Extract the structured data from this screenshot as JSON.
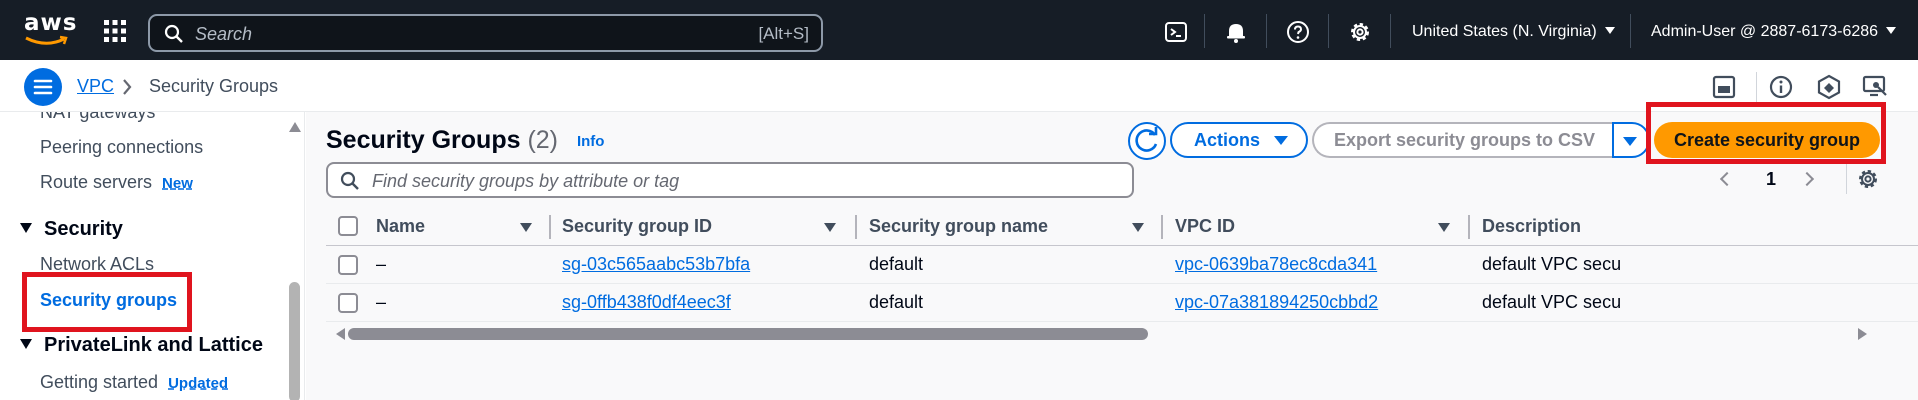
{
  "topbar": {
    "logo": "aws",
    "search_placeholder": "Search",
    "search_shortcut": "[Alt+S]",
    "region": "United States (N. Virginia)",
    "account": "Admin-User @ 2887-6173-6286",
    "icons": [
      "grid-icon",
      "search-icon",
      "cloudshell-icon",
      "bell-icon",
      "help-icon",
      "gear-icon"
    ]
  },
  "breadcrumb": {
    "root": "VPC",
    "current": "Security Groups"
  },
  "sidebar": {
    "items_top": [
      {
        "label": "NAT gateways"
      },
      {
        "label": "Peering connections"
      },
      {
        "label": "Route servers",
        "badge": "New"
      }
    ],
    "section_security": "Security",
    "security_items": [
      {
        "label": "Network ACLs"
      },
      {
        "label": "Security groups",
        "active": true
      }
    ],
    "section_privatelink": "PrivateLink and Lattice",
    "privatelink_items": [
      {
        "label": "Getting started",
        "badge": "Updated"
      }
    ]
  },
  "main": {
    "title": "Security Groups",
    "count": "(2)",
    "info": "Info",
    "actions_label": "Actions",
    "export_label": "Export security groups to CSV",
    "create_label": "Create security group",
    "filter_placeholder": "Find security groups by attribute or tag",
    "page": "1",
    "columns": [
      "Name",
      "Security group ID",
      "Security group name",
      "VPC ID",
      "Description"
    ],
    "rows": [
      {
        "name": "–",
        "sg_id": "sg-03c565aabc53b7bfa",
        "sg_name": "default",
        "vpc_id": "vpc-0639ba78ec8cda341",
        "description": "default VPC secu"
      },
      {
        "name": "–",
        "sg_id": "sg-0ffb438f0df4eec3f",
        "sg_name": "default",
        "vpc_id": "vpc-07a381894250cbbd2",
        "description": "default VPC secu"
      }
    ]
  },
  "colors": {
    "topbar_bg": "#161d26",
    "link": "#006ce0",
    "primary_button": "#ff9900",
    "highlight_box": "#e0141e"
  }
}
